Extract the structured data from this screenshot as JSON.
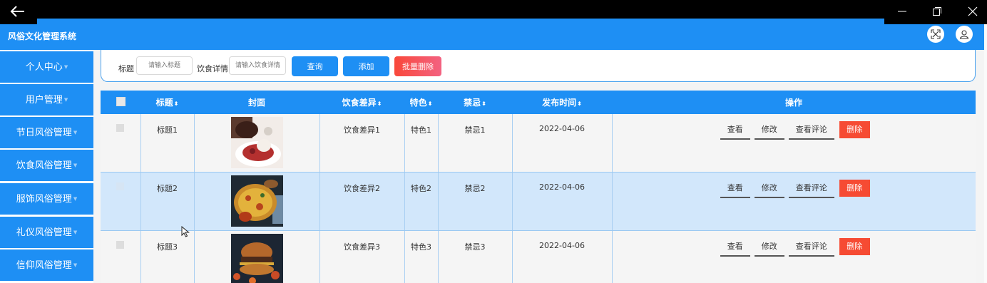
{
  "app": {
    "title": "风俗文化管理系统"
  },
  "window": {
    "back_icon": "arrow-left-icon",
    "controls": [
      "minimize-icon",
      "restore-icon",
      "close-icon"
    ]
  },
  "header": {
    "icons": [
      "fullscreen-icon",
      "user-icon"
    ]
  },
  "sidebar": {
    "items": [
      {
        "label": "个人中心"
      },
      {
        "label": "用户管理"
      },
      {
        "label": "节日风俗管理"
      },
      {
        "label": "饮食风俗管理"
      },
      {
        "label": "服饰风俗管理"
      },
      {
        "label": "礼仪风俗管理"
      },
      {
        "label": "信仰风俗管理"
      }
    ]
  },
  "search": {
    "title_label": "标题",
    "title_placeholder": "请输入标题",
    "detail_label": "饮食详情",
    "detail_placeholder": "请输入饮食详情",
    "query_btn": "查询",
    "add_btn": "添加",
    "batch_delete_btn": "批量删除"
  },
  "table": {
    "headers": {
      "title": "标题",
      "cover": "封面",
      "diff": "饮食差异",
      "feature": "特色",
      "taboo": "禁忌",
      "time": "发布时间",
      "ops": "操作"
    },
    "sort_icon": "sort-icon",
    "ops": {
      "view": "查看",
      "edit": "修改",
      "comments": "查看评论",
      "delete": "删除"
    },
    "rows": [
      {
        "title": "标题1",
        "diff": "饮食差异1",
        "feature": "特色1",
        "taboo": "禁忌1",
        "time": "2022-04-06",
        "cover": "dessert-photo"
      },
      {
        "title": "标题2",
        "diff": "饮食差异2",
        "feature": "特色2",
        "taboo": "禁忌2",
        "time": "2022-04-06",
        "cover": "pizza-photo"
      },
      {
        "title": "标题3",
        "diff": "饮食差异3",
        "feature": "特色3",
        "taboo": "禁忌3",
        "time": "2022-04-06",
        "cover": "burger-photo"
      }
    ]
  },
  "colors": {
    "primary": "#1e8ff4",
    "danger": "#f64b33",
    "selected_row": "#d2e7fb"
  }
}
